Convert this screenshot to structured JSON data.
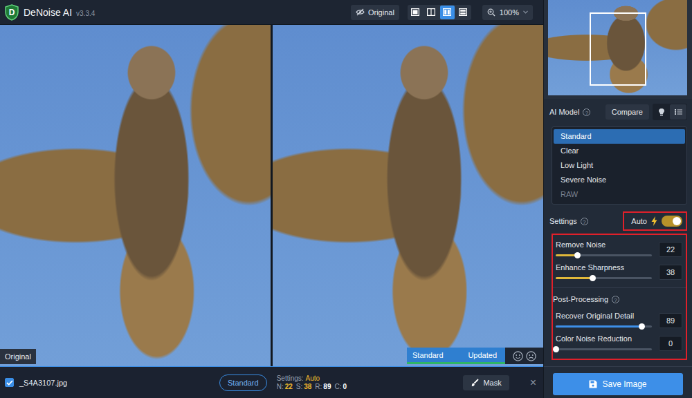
{
  "app": {
    "logo_letter": "D",
    "name": "DeNoise AI",
    "version": "v3.3.4"
  },
  "toolbar": {
    "original_button": "Original",
    "view_modes": [
      {
        "kind": "single",
        "selected": false
      },
      {
        "kind": "split",
        "selected": false
      },
      {
        "kind": "sidebyside",
        "selected": true
      },
      {
        "kind": "stacked",
        "selected": false
      }
    ],
    "zoom": "100%"
  },
  "preview": {
    "left_label": "Original",
    "right_model": "Standard",
    "right_status": "Updated"
  },
  "help_icon": "?",
  "ai_model": {
    "label": "AI Model",
    "compare_button": "Compare",
    "view_toggles": [
      {
        "selected": false
      },
      {
        "selected": true
      }
    ],
    "models": [
      {
        "label": "Standard",
        "selected": true,
        "disabled": false
      },
      {
        "label": "Clear",
        "selected": false,
        "disabled": false
      },
      {
        "label": "Low Light",
        "selected": false,
        "disabled": false
      },
      {
        "label": "Severe Noise",
        "selected": false,
        "disabled": false
      },
      {
        "label": "RAW",
        "selected": false,
        "disabled": true
      }
    ]
  },
  "settings": {
    "label": "Settings",
    "annotated": true,
    "auto": {
      "label": "Auto",
      "on": true,
      "annotated": true
    },
    "sliders": [
      {
        "label": "Remove Noise",
        "value": "22",
        "level": 0.22,
        "color": "#e0b83a"
      },
      {
        "label": "Enhance Sharpness",
        "value": "38",
        "level": 0.38,
        "color": "#e0b83a"
      }
    ],
    "post_processing": {
      "label": "Post-Processing",
      "sliders": [
        {
          "label": "Recover Original Detail",
          "value": "89",
          "level": 0.89,
          "color": "#3d8fe8"
        },
        {
          "label": "Color Noise Reduction",
          "value": "0",
          "level": 0,
          "color": "#3d8fe8"
        }
      ]
    }
  },
  "save_button": "Save Image",
  "file_bar": {
    "checked": true,
    "filename": "_S4A3107.jpg",
    "model_button": "Standard",
    "settings_label": "Settings:",
    "settings_value": "Auto",
    "stats": [
      {
        "key": "N:",
        "value": "22",
        "color": "#f0b92e"
      },
      {
        "key": "S:",
        "value": "38",
        "color": "#f0b92e"
      },
      {
        "key": "R:",
        "value": "89",
        "color": "#ffffff"
      },
      {
        "key": "C:",
        "value": "0",
        "color": "#ffffff"
      }
    ],
    "mask_button": "Mask",
    "close_icon": "×"
  }
}
